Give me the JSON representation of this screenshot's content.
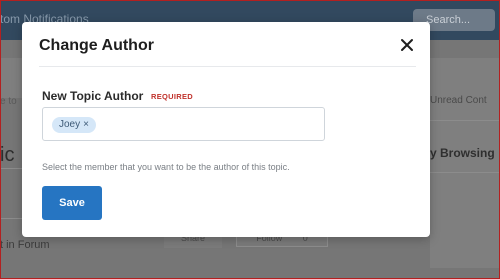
{
  "background": {
    "notifications_label": "tom Notifications",
    "search_placeholder": "Search...",
    "unread_label": "Unread Cont",
    "browsing_label": "y Browsing",
    "topic_label": "ic",
    "forum_label": "t in Forum",
    "left_fragment": "e to",
    "share_label": "Share",
    "follow_label": "Follow",
    "follow_count": "0"
  },
  "modal": {
    "title": "Change Author",
    "close_icon": "close-icon",
    "field_label": "New Topic Author",
    "required_badge": "REQUIRED",
    "selected_member": "Joey",
    "remove_symbol": "×",
    "help_text": "Select the member that you want to be the author of this topic.",
    "save_label": "Save"
  },
  "colors": {
    "accent": "#2675c2",
    "required": "#c0312b",
    "token_bg": "#d5e7f8"
  }
}
